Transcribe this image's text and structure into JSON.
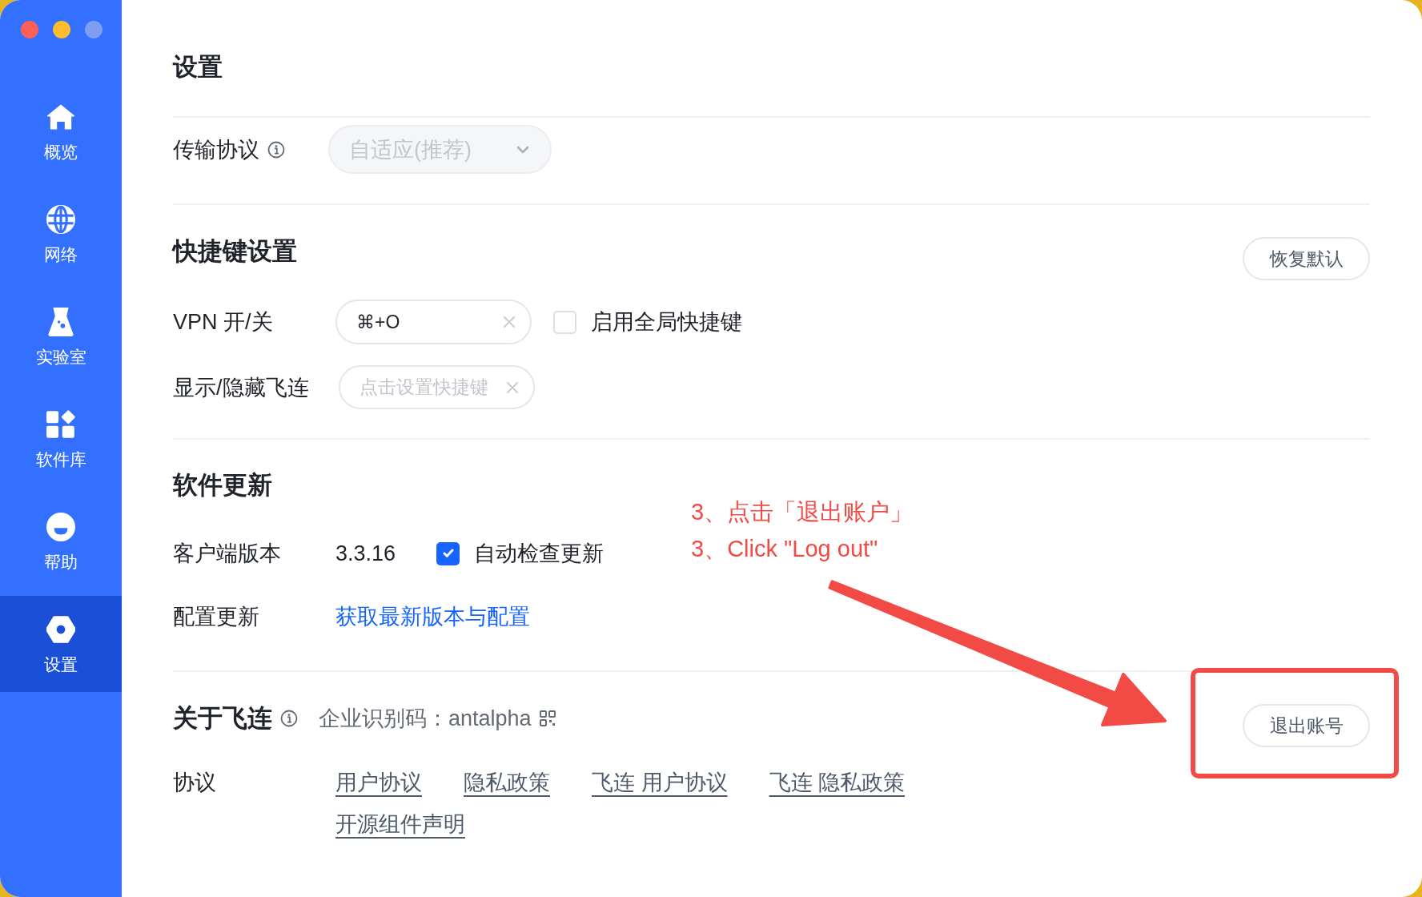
{
  "window": {
    "traffic_lights": [
      {
        "color": "#ff5f57"
      },
      {
        "color": "#febc2e"
      },
      {
        "color": "#7f9ef2"
      }
    ]
  },
  "sidebar": {
    "items": [
      {
        "kind": "home",
        "label": "概览",
        "selected": false
      },
      {
        "kind": "globe",
        "label": "网络",
        "selected": false
      },
      {
        "kind": "flask",
        "label": "实验室",
        "selected": false
      },
      {
        "kind": "apps",
        "label": "软件库",
        "selected": false
      },
      {
        "kind": "help",
        "label": "帮助",
        "selected": false
      },
      {
        "kind": "settings",
        "label": "设置",
        "selected": true
      }
    ]
  },
  "page": {
    "title": "设置"
  },
  "transport": {
    "label": "传输协议",
    "value": "自适应(推荐)",
    "disabled": true
  },
  "shortcuts": {
    "title": "快捷键设置",
    "reset_button": "恢复默认",
    "rows": [
      {
        "label": "VPN 开/关",
        "value": "⌘+O",
        "checkbox": {
          "label": "启用全局快捷键",
          "checked": false
        }
      },
      {
        "label": "显示/隐藏飞连",
        "placeholder": "点击设置快捷键"
      }
    ]
  },
  "update": {
    "title": "软件更新",
    "version_label": "客户端版本",
    "version": "3.3.16",
    "auto_check": {
      "label": "自动检查更新",
      "checked": true
    },
    "config_label": "配置更新",
    "config_link": "获取最新版本与配置"
  },
  "about": {
    "title": "关于飞连",
    "org_id": "企业识别码：antalpha",
    "logout_button": "退出账号",
    "agreements_label": "协议",
    "links": [
      "用户协议",
      "隐私政策",
      "飞连 用户协议",
      "飞连 隐私政策",
      "开源组件声明"
    ]
  },
  "annotation": {
    "lines": [
      "3、点击「退出账户」",
      "3、Click \"Log out\""
    ]
  }
}
